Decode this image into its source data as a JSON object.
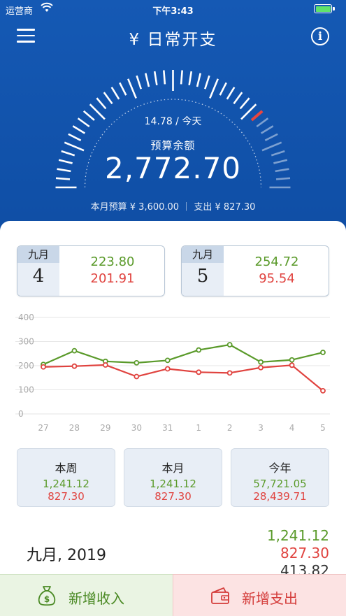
{
  "status": {
    "carrier": "运营商",
    "time": "下午3:43"
  },
  "header": {
    "title": "¥ 日常开支"
  },
  "gauge": {
    "per_day": "14.78 / 今天",
    "remaining_label": "预算余额",
    "remaining_value": "2,772.70",
    "budget_line": "本月预算 ¥ 3,600.00 ｜ 支出 ¥ 827.30",
    "spent_fraction": 0.23
  },
  "days": [
    {
      "month": "九月",
      "day": "4",
      "income": "223.80",
      "expense": "201.91"
    },
    {
      "month": "九月",
      "day": "5",
      "income": "254.72",
      "expense": "95.54"
    }
  ],
  "chart_data": {
    "type": "line",
    "categories": [
      "27",
      "28",
      "29",
      "30",
      "31",
      "1",
      "2",
      "3",
      "4",
      "5"
    ],
    "y_ticks": [
      "400",
      "300",
      "200",
      "100",
      "0"
    ],
    "ylim": [
      0,
      400
    ],
    "grid": true,
    "series": [
      {
        "values": [
          205,
          262,
          218,
          212,
          222,
          265,
          287,
          215,
          224,
          255
        ],
        "color": "#5a9a2a"
      },
      {
        "values": [
          195,
          198,
          203,
          155,
          187,
          173,
          170,
          192,
          202,
          96
        ],
        "color": "#e0433f"
      }
    ]
  },
  "summary": [
    {
      "label": "本周",
      "income": "1,241.12",
      "expense": "827.30"
    },
    {
      "label": "本月",
      "income": "1,241.12",
      "expense": "827.30"
    },
    {
      "label": "今年",
      "income": "57,721.05",
      "expense": "28,439.71"
    }
  ],
  "month_section": {
    "title": "九月, 2019",
    "income": "1,241.12",
    "expense": "827.30",
    "balance": "413.82"
  },
  "actions": {
    "add_income": "新增收入",
    "add_expense": "新增支出"
  },
  "colors": {
    "primary": "#1559b4",
    "income": "#5a9a2a",
    "expense": "#e0433f"
  }
}
